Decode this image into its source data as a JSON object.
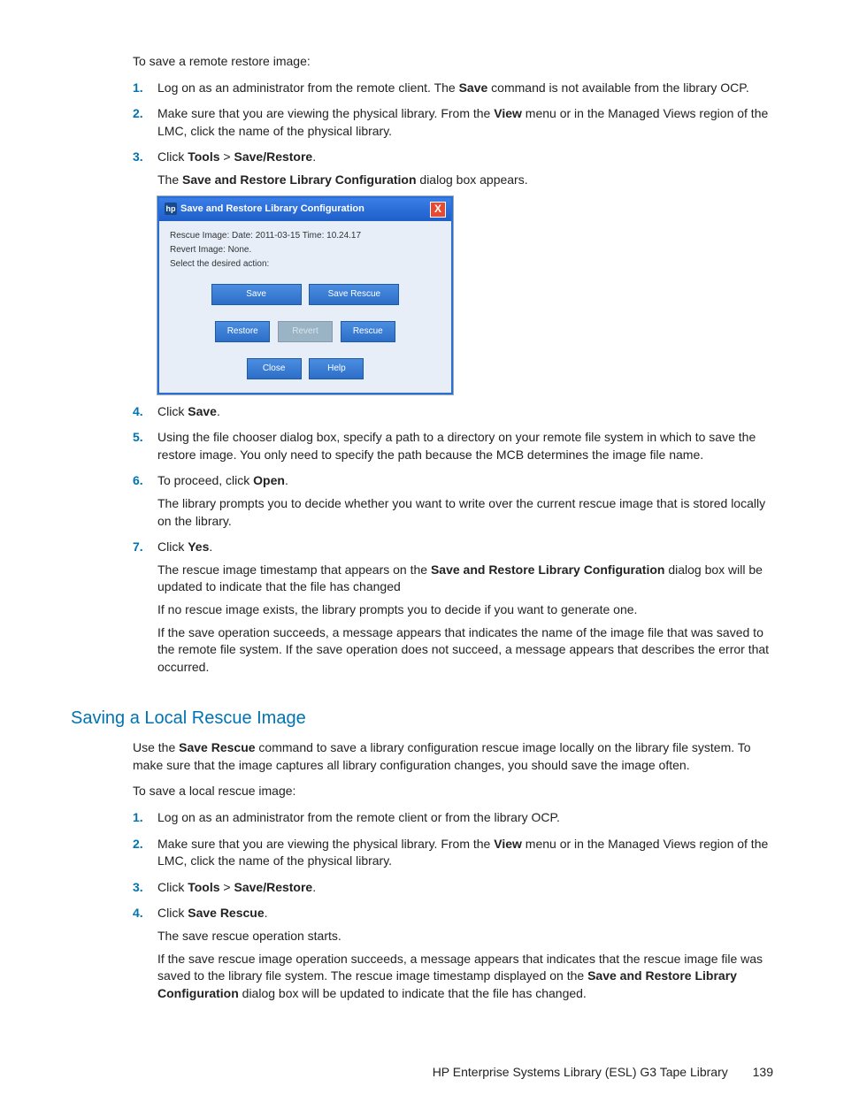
{
  "intro1": "To save a remote restore image:",
  "list1": {
    "i1": {
      "num": "1.",
      "text_a": "Log on as an administrator from the remote client. The ",
      "b1": "Save",
      "text_b": " command is not available from the library OCP."
    },
    "i2": {
      "num": "2.",
      "text_a": "Make sure that you are viewing the physical library. From the ",
      "b1": "View",
      "text_b": " menu or in the Managed Views region of the LMC, click the name of the physical library."
    },
    "i3": {
      "num": "3.",
      "text_a": "Click ",
      "b1": "Tools",
      "gt": " > ",
      "b2": "Save/Restore",
      "text_b": ".",
      "after_a": "The ",
      "after_b": "Save and Restore Library Configuration",
      "after_c": " dialog box appears."
    },
    "i4": {
      "num": "4.",
      "text_a": "Click ",
      "b1": "Save",
      "text_b": "."
    },
    "i5": {
      "num": "5.",
      "text": "Using the file chooser dialog box, specify a path to a directory on your remote file system in which to save the restore image. You only need to specify the path because the MCB determines the image file name."
    },
    "i6": {
      "num": "6.",
      "text_a": "To proceed, click ",
      "b1": "Open",
      "text_b": ".",
      "after": "The library prompts you to decide whether you want to write over the current rescue image that is stored locally on the library."
    },
    "i7": {
      "num": "7.",
      "text_a": "Click ",
      "b1": "Yes",
      "text_b": ".",
      "p1a": "The rescue image timestamp that appears on the ",
      "p1b": "Save and Restore Library Configuration",
      "p1c": " dialog box will be updated to indicate that the file has changed",
      "p2": "If no rescue image exists, the library prompts you to decide if you want to generate one.",
      "p3": "If the save operation succeeds, a message appears that indicates the name of the image file that was saved to the remote file system. If the save operation does not succeed, a message appears that describes the error that occurred."
    }
  },
  "dialog": {
    "title": "Save and Restore Library Configuration",
    "line1": "Rescue Image: Date: 2011-03-15 Time: 10.24.17",
    "line2": "Revert Image: None.",
    "line3": "Select the desired action:",
    "btn_save": "Save",
    "btn_saverescue": "Save Rescue",
    "btn_restore": "Restore",
    "btn_revert": "Revert",
    "btn_rescue": "Rescue",
    "btn_close": "Close",
    "btn_help": "Help"
  },
  "section2_title": "Saving a Local Rescue Image",
  "section2_intro_a": "Use the ",
  "section2_intro_b": "Save Rescue",
  "section2_intro_c": " command to save a library configuration rescue image locally on the library file system. To make sure that the image captures all library configuration changes, you should save the image often.",
  "intro2": "To save a local rescue image:",
  "list2": {
    "i1": {
      "num": "1.",
      "text": "Log on as an administrator from the remote client or from the library OCP."
    },
    "i2": {
      "num": "2.",
      "text_a": "Make sure that you are viewing the physical library. From the ",
      "b1": "View",
      "text_b": " menu or in the Managed Views region of the LMC, click the name of the physical library."
    },
    "i3": {
      "num": "3.",
      "text_a": "Click ",
      "b1": "Tools",
      "gt": " > ",
      "b2": "Save/Restore",
      "text_b": "."
    },
    "i4": {
      "num": "4.",
      "text_a": "Click ",
      "b1": "Save Rescue",
      "text_b": ".",
      "p1": "The save rescue operation starts.",
      "p2a": "If the save rescue image operation succeeds, a message appears that indicates that the rescue image file was saved to the library file system. The rescue image timestamp displayed on the ",
      "p2b": "Save and Restore Library Configuration",
      "p2c": " dialog box will be updated to indicate that the file has changed."
    }
  },
  "footer_text": "HP Enterprise Systems Library (ESL) G3 Tape Library",
  "page_num": "139"
}
